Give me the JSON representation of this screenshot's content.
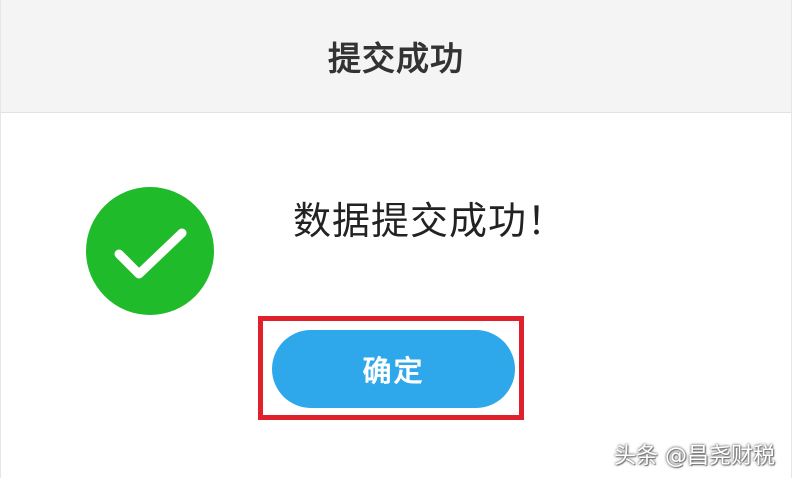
{
  "dialog": {
    "title": "提交成功",
    "message": "数据提交成功！",
    "confirm_label": "确定",
    "icon": "check-circle-icon"
  },
  "colors": {
    "success_green": "#1fbb2a",
    "button_blue": "#2ea8ea",
    "highlight_red": "#e0202a",
    "header_bg": "#f4f4f4"
  },
  "watermark": {
    "text": "头条 @昌尧财税"
  }
}
